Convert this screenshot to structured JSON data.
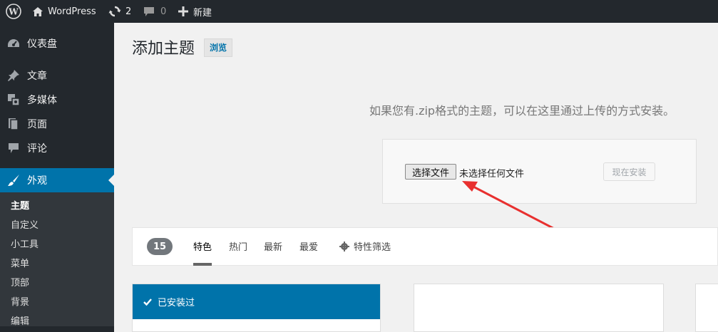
{
  "admin_bar": {
    "site_name": "WordPress",
    "updates_count": "2",
    "comments_count": "0",
    "new_label": "新建"
  },
  "sidebar": {
    "menu": [
      {
        "label": "仪表盘",
        "icon": "dashboard-icon"
      },
      {
        "label": "文章",
        "icon": "pin-icon"
      },
      {
        "label": "多媒体",
        "icon": "media-icon"
      },
      {
        "label": "页面",
        "icon": "page-icon"
      },
      {
        "label": "评论",
        "icon": "comment-icon"
      },
      {
        "label": "外观",
        "icon": "paintbrush-icon"
      }
    ],
    "submenu": [
      "主题",
      "自定义",
      "小工具",
      "菜单",
      "顶部",
      "背景",
      "编辑"
    ]
  },
  "main": {
    "title": "添加主题",
    "browse_label": "浏览",
    "upload_help": "如果您有.zip格式的主题，可以在这里通过上传的方式安装。",
    "choose_file_label": "选择文件",
    "no_file_label": "未选择任何文件",
    "install_now_label": "现在安装",
    "theme_count": "15",
    "tabs": [
      "特色",
      "热门",
      "最新",
      "最爱"
    ],
    "feature_filter_label": "特性筛选",
    "installed_label": "已安装过"
  },
  "colors": {
    "accent": "#0073aa",
    "adminbar_bg": "#23282d",
    "arrow": "#e8302f"
  }
}
